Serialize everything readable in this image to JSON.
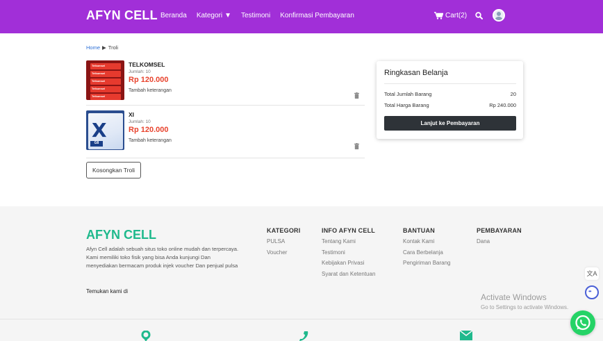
{
  "navbar": {
    "brand": "AFYN CELL",
    "links": [
      "Beranda",
      "Kategori",
      "Testimoni",
      "Konfirmasi Pembayaran"
    ],
    "cart_label": "Cart(2)",
    "color": "#a12fd8"
  },
  "breadcrumb": {
    "home": "Home",
    "separator": "▶",
    "current": "Troli"
  },
  "cart_items": [
    {
      "name": "TELKOMSEL",
      "qty": "Jumlah: 10",
      "price": "Rp 120.000",
      "note": "Tambah keterangan",
      "thumb_labels": [
        "Telkomsel",
        "Telkomsel",
        "Telkomsel",
        "Telkomsel",
        "Telkomsel"
      ]
    },
    {
      "name": "XI",
      "qty": "Jumlah: 10",
      "price": "Rp 120.000",
      "note": "Tambah keterangan",
      "thumb_labels": [
        "X",
        "G8"
      ]
    }
  ],
  "empty_cart_label": "Kosongkan Troli",
  "summary": {
    "title": "Ringkasan Belanja",
    "rows": [
      {
        "label": "Total Jumlah Barang",
        "value": "20"
      },
      {
        "label": "Total Harga Barang",
        "value": "Rp 240.000"
      }
    ],
    "checkout_label": "Lanjut ke Pembayaran"
  },
  "footer": {
    "brand": "AFYN CELL",
    "brand_color": "#1fb98c",
    "description": "Afyn Cell adalah sebuah situs toko online mudah dan terpercaya. Kami memiliki toko fisik yang bisa Anda kunjungi Dan menyediakan bermacam produk injek voucher Dan penjual pulsa",
    "find_us": "Temukan kami di",
    "columns": [
      {
        "title": "KATEGORI",
        "items": [
          "PULSA",
          "Voucher"
        ]
      },
      {
        "title": "INFO AFYN CELL",
        "items": [
          "Tentang Kami",
          "Testimoni",
          "Kebijakan Privasi",
          "Syarat dan Ketentuan"
        ]
      },
      {
        "title": "BANTUAN",
        "items": [
          "Kontak Kami",
          "Cara Berbelanja",
          "Pengiriman Barang"
        ]
      },
      {
        "title": "PEMBAYARAN",
        "items": [
          "Dana"
        ]
      }
    ]
  },
  "watermark": {
    "title": "Activate Windows",
    "subtitle": "Go to Settings to activate Windows."
  },
  "side": {
    "translate_glyph": "文A"
  },
  "colors": {
    "price": "#e8432d",
    "checkout_button": "#2e3338",
    "whatsapp": "#25d366"
  }
}
